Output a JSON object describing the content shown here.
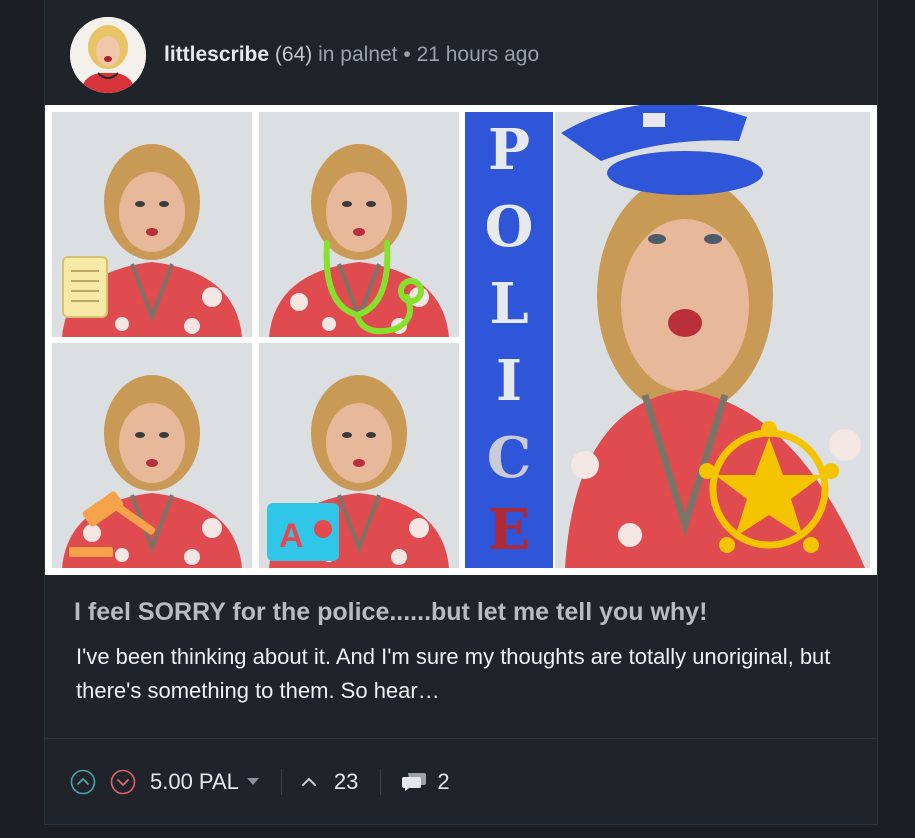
{
  "post": {
    "author": "littlescribe",
    "reputation": "(64)",
    "in_label": "in",
    "community": "palnet",
    "bullet": "•",
    "time_ago": "21 hours ago",
    "title": "I feel SORRY for the police......but let me tell you why!",
    "excerpt": "I've been thinking about it. And I'm sure my thoughts are totally unoriginal, but there's something to them. So hear…"
  },
  "thumbnail": {
    "banner_letters": [
      "P",
      "O",
      "L",
      "I",
      "C",
      "E"
    ],
    "icons": [
      "scroll-icon",
      "stethoscope-icon",
      "gavel-icon",
      "teacher-apple-icon",
      "police-cap-icon",
      "sheriff-star-icon"
    ]
  },
  "footer": {
    "payout": "5.00 PAL",
    "votes": "23",
    "comments": "2"
  },
  "colors": {
    "background": "#1b1f24",
    "card": "#1e242a",
    "upvote": "#4aa3a8",
    "downvote": "#e4606f",
    "police_blue": "#2f56d8",
    "badge_gold": "#f4c400"
  }
}
